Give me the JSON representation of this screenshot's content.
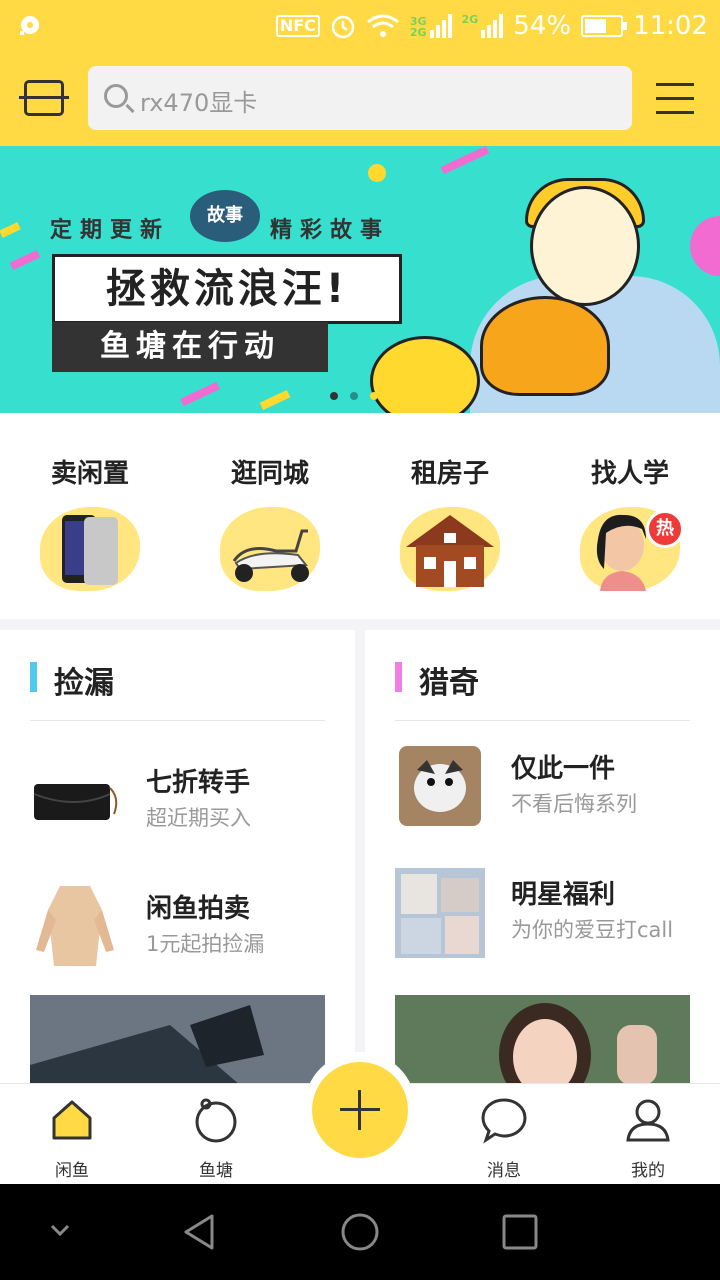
{
  "status_bar": {
    "nfc_label": "NFC",
    "net_3g_label": "3G",
    "net_2g_label": "2G",
    "battery_percent": "54%",
    "battery_level": 0.54,
    "time": "11:02"
  },
  "header": {
    "search_placeholder": "rx470显卡",
    "scan_icon": "scan-icon",
    "menu_icon": "menu-icon"
  },
  "banner": {
    "top_left_text": "定期更新",
    "logo_text": "故事",
    "top_right_text": "精彩故事",
    "headline": "拯救流浪汪!",
    "subline": "鱼塘在行动",
    "page_count": 3,
    "active_page": 0
  },
  "categories": [
    {
      "label": "卖闲置",
      "icon": "phone-image"
    },
    {
      "label": "逛同城",
      "icon": "scooter-image"
    },
    {
      "label": "租房子",
      "icon": "house-image"
    },
    {
      "label": "找人学",
      "icon": "person-image",
      "badge": "热"
    }
  ],
  "panels": {
    "left": {
      "title": "捡漏",
      "accent": "#4fc9ef",
      "items": [
        {
          "name": "七折转手",
          "desc": "超近期买入"
        },
        {
          "name": "闲鱼拍卖",
          "desc": "1元起拍捡漏"
        }
      ]
    },
    "right": {
      "title": "猎奇",
      "accent": "#f07ee4",
      "items": [
        {
          "name": "仅此一件",
          "desc": "不看后悔系列"
        },
        {
          "name": "明星福利",
          "desc": "为你的爱豆打call"
        }
      ]
    }
  },
  "bottom_nav": {
    "items": [
      {
        "label": "闲鱼",
        "icon": "home-icon"
      },
      {
        "label": "鱼塘",
        "icon": "pond-icon"
      },
      {
        "label": "消息",
        "icon": "message-icon"
      },
      {
        "label": "我的",
        "icon": "profile-icon"
      }
    ],
    "publish_icon": "plus-icon"
  },
  "colors": {
    "brand_yellow": "#ffda44",
    "banner_bg": "#37dfcf"
  }
}
